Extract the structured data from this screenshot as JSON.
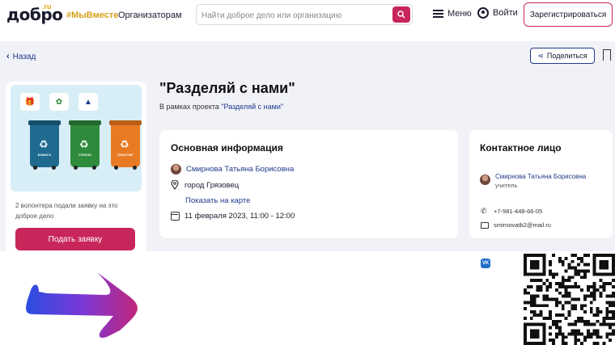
{
  "header": {
    "logo": "добро",
    "logo_suffix": ".ru",
    "hashtag": "#МыВместе",
    "organizers": "Организаторам",
    "search_placeholder": "Найти доброе дело или организацию",
    "menu": "Меню",
    "login": "Войти",
    "register": "Зарегистрироваться"
  },
  "nav": {
    "back": "Назад",
    "share": "Поделиться"
  },
  "hero": {
    "bins": [
      {
        "label": "БУМАГА",
        "color": "#1f6a8f"
      },
      {
        "label": "СТЕКЛО",
        "color": "#2e8b3c"
      },
      {
        "label": "ПЛАСТИК",
        "color": "#e87a24"
      }
    ]
  },
  "left_card": {
    "volunteers_text": "2 волонтера подали заявку на это доброе дело",
    "apply_button": "Подать заявку"
  },
  "event": {
    "title": "\"Разделяй с нами\"",
    "subtitle_prefix": "В рамках проекта ",
    "project_link": "\"Разделяй с нами\""
  },
  "info": {
    "heading": "Основная информация",
    "organizer": "Смирнова Татьяна Борисовна",
    "city": "город Грязовец",
    "map_link": "Показать на карте",
    "datetime": "11 февраля 2023, 11:00 - 12:00"
  },
  "contact": {
    "heading": "Контактное лицо",
    "name": "Смирнова Татьяна Борисовна",
    "role": "учитель",
    "phone": "+7-981-448-66-05",
    "email": "smirnovatb2@mail.ru",
    "social": "VK"
  },
  "colors": {
    "accent": "#c8265a",
    "link": "#1f3a8a",
    "hashtag": "#d4a017",
    "background": "#f1f2f7"
  }
}
